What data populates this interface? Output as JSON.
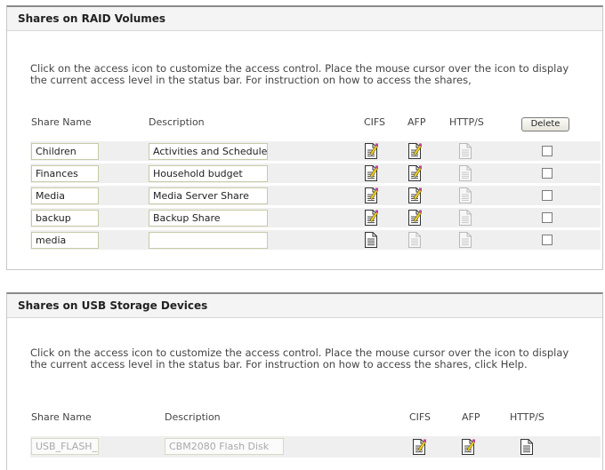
{
  "raid": {
    "title": "Shares on RAID Volumes",
    "intro": "Click on the access icon to customize the access control. Place the mouse cursor over the icon to display the current access level in the status bar. For instruction on how to access the shares,",
    "columns": {
      "share_name": "Share Name",
      "description": "Description",
      "cifs": "CIFS",
      "afp": "AFP",
      "http": "HTTP/S"
    },
    "delete_label": "Delete",
    "rows": [
      {
        "name": "Children",
        "description": "Activities and Schedule",
        "cifs": "edit-access-icon",
        "afp": "edit-access-icon",
        "http": "no-access-icon",
        "checked": false
      },
      {
        "name": "Finances",
        "description": "Household budget",
        "cifs": "edit-access-icon",
        "afp": "edit-access-icon",
        "http": "no-access-icon",
        "checked": false
      },
      {
        "name": "Media",
        "description": "Media Server Share",
        "cifs": "edit-access-icon",
        "afp": "edit-access-icon",
        "http": "no-access-icon",
        "checked": false
      },
      {
        "name": "backup",
        "description": "Backup Share",
        "cifs": "edit-access-icon",
        "afp": "edit-access-icon",
        "http": "no-access-icon",
        "checked": false
      },
      {
        "name": "media",
        "description": "",
        "cifs": "read-access-icon",
        "afp": "no-access-icon",
        "http": "no-access-icon",
        "checked": false
      }
    ]
  },
  "usb": {
    "title": "Shares on USB Storage Devices",
    "intro": "Click on the access icon to customize the access control. Place the mouse cursor over the icon to display the current access level in the status bar. For instruction on how to access the shares, click Help.",
    "columns": {
      "share_name": "Share Name",
      "description": "Description",
      "cifs": "CIFS",
      "afp": "AFP",
      "http": "HTTP/S"
    },
    "rows": [
      {
        "name": "USB_FLASH_",
        "description": "CBM2080 Flash Disk",
        "cifs": "edit-access-icon",
        "afp": "edit-access-icon",
        "http": "read-access-icon"
      }
    ]
  }
}
